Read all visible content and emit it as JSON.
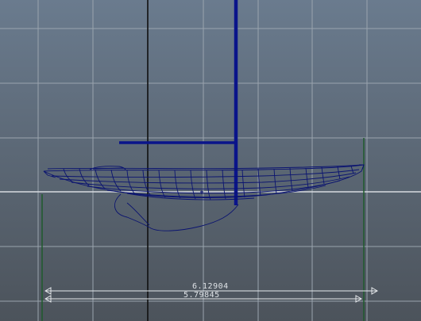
{
  "viewport": {
    "colors": {
      "background_top": "#6a7b8e",
      "background_bottom": "#4c535b",
      "grid_line": "#9aa4ae",
      "axis_line": "#101010",
      "ground_line": "#d7dbe0",
      "model_wire": "#0b1470",
      "mast": "#0a148a",
      "construction_line": "#1f5a2c",
      "dimension_line": "#e6e9ec",
      "dimension_text": "#dfe3e7"
    },
    "dimensions": [
      {
        "value": "6.12904"
      },
      {
        "value": "5.79845"
      }
    ]
  }
}
